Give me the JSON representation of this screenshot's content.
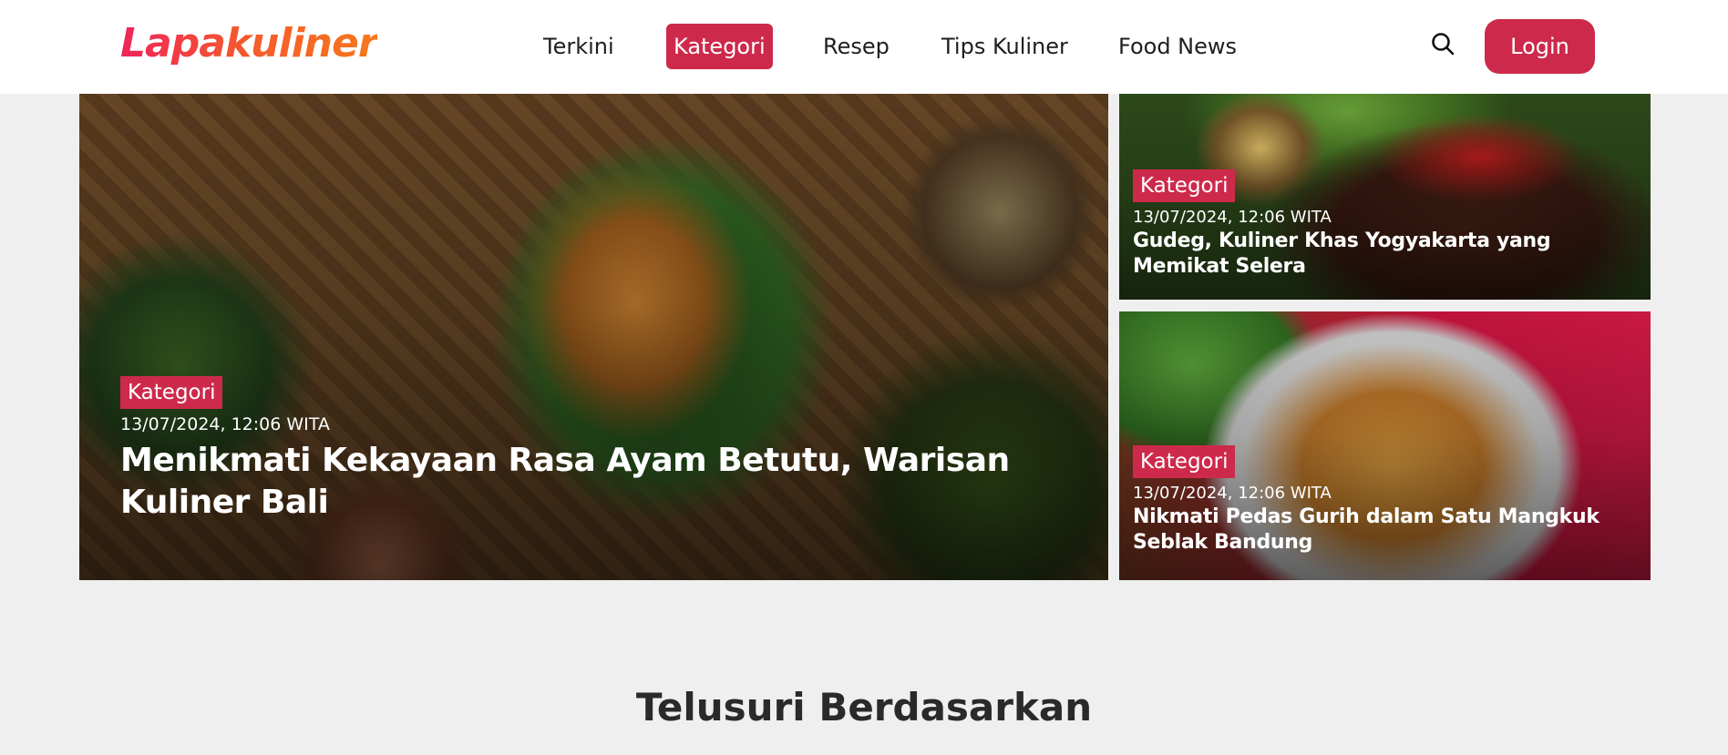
{
  "header": {
    "logo_text": "Lapakuliner",
    "nav": [
      {
        "label": "Terkini",
        "active": false
      },
      {
        "label": "Kategori",
        "active": true
      },
      {
        "label": "Resep",
        "active": false
      },
      {
        "label": "Tips Kuliner",
        "active": false
      },
      {
        "label": "Food News",
        "active": false
      }
    ],
    "search_icon": "search-icon",
    "login_label": "Login"
  },
  "hero": {
    "main": {
      "category": "Kategori",
      "date": "13/07/2024, 12:06 WITA",
      "title": "Menikmati Kekayaan Rasa Ayam Betutu, Warisan Kuliner Bali"
    },
    "side": [
      {
        "category": "Kategori",
        "date": "13/07/2024, 12:06 WITA",
        "title": "Gudeg, Kuliner Khas Yogyakarta yang Memikat Selera"
      },
      {
        "category": "Kategori",
        "date": "13/07/2024, 12:06 WITA",
        "title": "Nikmati Pedas Gurih dalam Satu Mangkuk Seblak Bandung"
      }
    ]
  },
  "section": {
    "title": "Telusuri Berdasarkan"
  },
  "colors": {
    "accent": "#cd2a4b",
    "page_bg": "#efefef",
    "logo_gradient_start": "#f0245a",
    "logo_gradient_end": "#f7781d"
  }
}
